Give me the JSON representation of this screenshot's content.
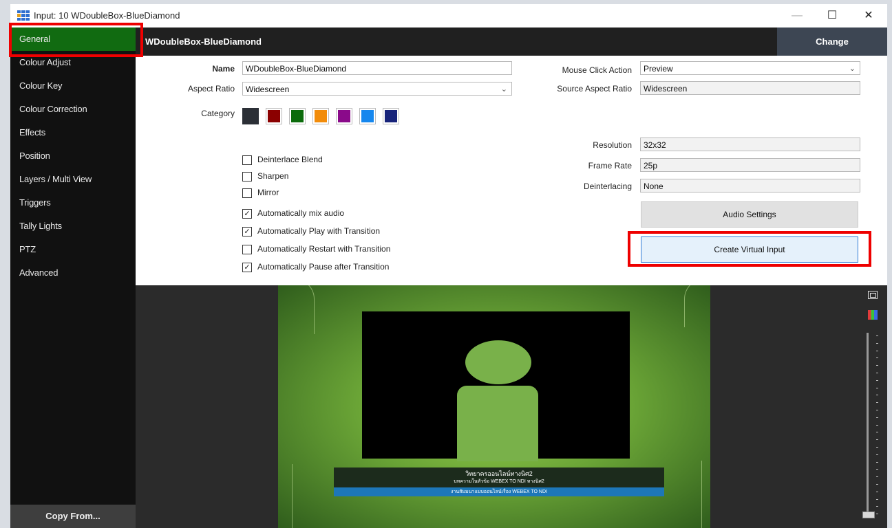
{
  "window": {
    "title": "Input: 10 WDoubleBox-BlueDiamond",
    "minimize_icon": "—",
    "maximize_icon": "☐",
    "close_icon": "✕"
  },
  "sidebar": {
    "items": [
      {
        "label": "General",
        "active": true
      },
      {
        "label": "Colour Adjust"
      },
      {
        "label": "Colour Key"
      },
      {
        "label": "Colour Correction"
      },
      {
        "label": "Effects"
      },
      {
        "label": "Position"
      },
      {
        "label": "Layers / Multi View"
      },
      {
        "label": "Triggers"
      },
      {
        "label": "Tally Lights"
      },
      {
        "label": "PTZ"
      },
      {
        "label": "Advanced"
      }
    ],
    "copy_from": "Copy From..."
  },
  "header": {
    "title": "WDoubleBox-BlueDiamond",
    "change_label": "Change"
  },
  "form": {
    "name_label": "Name",
    "name_value": "WDoubleBox-BlueDiamond",
    "aspect_label": "Aspect Ratio",
    "aspect_value": "Widescreen",
    "category_label": "Category",
    "category_colors": [
      "#2b2f36",
      "#8b0000",
      "#0b6b0b",
      "#f28c0a",
      "#8a0a8a",
      "#1587ee",
      "#17237a"
    ],
    "mouse_click_label": "Mouse Click Action",
    "mouse_click_value": "Preview",
    "source_aspect_label": "Source Aspect Ratio",
    "source_aspect_value": "Widescreen",
    "resolution_label": "Resolution",
    "resolution_value": "32x32",
    "frame_rate_label": "Frame Rate",
    "frame_rate_value": "25p",
    "deinterlacing_label": "Deinterlacing",
    "deinterlacing_value": "None",
    "audio_settings_label": "Audio Settings",
    "create_virtual_label": "Create Virtual Input",
    "checkboxes": [
      {
        "label": "Deinterlace Blend",
        "checked": false
      },
      {
        "label": "Sharpen",
        "checked": false
      },
      {
        "label": "Mirror",
        "checked": false
      },
      {
        "label": "Automatically mix audio",
        "checked": true
      },
      {
        "label": "Automatically Play with Transition",
        "checked": true
      },
      {
        "label": "Automatically Restart with Transition",
        "checked": false
      },
      {
        "label": "Automatically Pause after Transition",
        "checked": true
      }
    ]
  },
  "preview": {
    "line1": "วิทยาครออนไลน์ทางนิศ2",
    "line2": "บทความในหัวข้อ WEBEX TO NDI ทางนิศ2",
    "line3": "งานสัมมนาแบบออนไลน์เรื่อง WEBEX TO NDI"
  },
  "colors": {
    "active_green": "#116b11",
    "highlight_red": "#ee0000"
  }
}
